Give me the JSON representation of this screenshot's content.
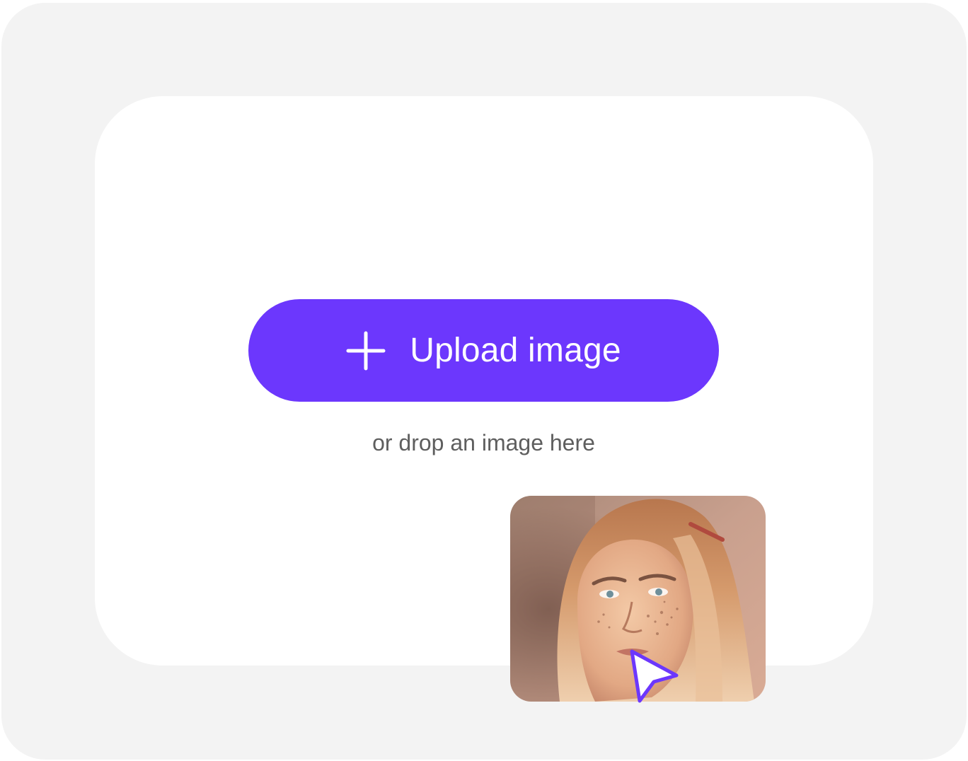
{
  "upload": {
    "button_label": "Upload image",
    "hint": "or drop an image here"
  },
  "icons": {
    "button_icon": "plus-icon",
    "cursor_icon": "pointer-cursor-icon"
  },
  "colors": {
    "accent": "#6c37fd",
    "frame_background": "#f3f3f3",
    "drop_zone_background": "#ffffff",
    "hint_text": "#5e5e5e"
  }
}
